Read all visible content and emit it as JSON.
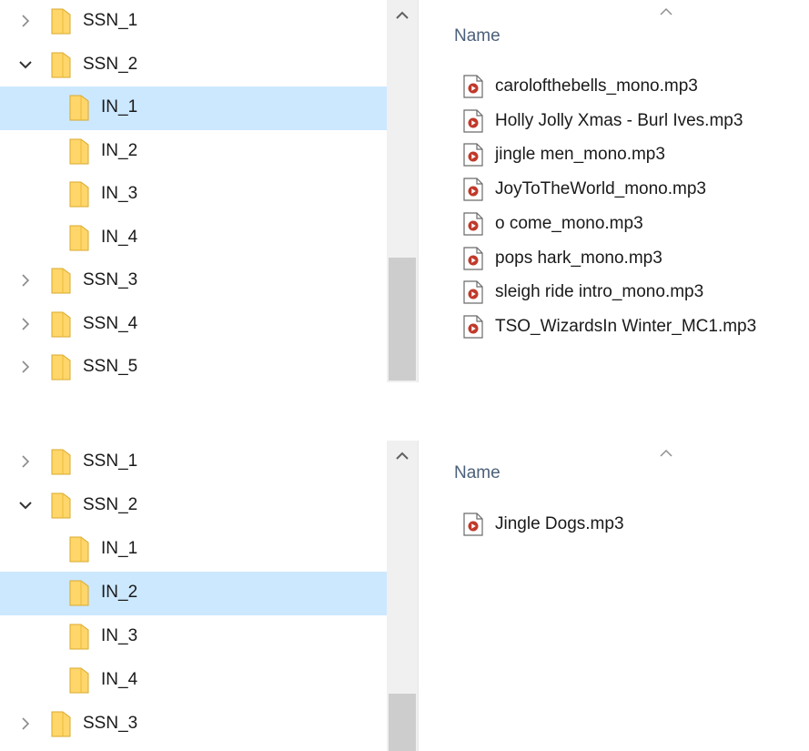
{
  "top": {
    "tree": [
      {
        "label": "SSN_1",
        "expand": "collapsed"
      },
      {
        "label": "SSN_2",
        "expand": "expanded"
      },
      {
        "label": "IN_1",
        "expand": "none",
        "selected": true
      },
      {
        "label": "IN_2",
        "expand": "none"
      },
      {
        "label": "IN_3",
        "expand": "none"
      },
      {
        "label": "IN_4",
        "expand": "none"
      },
      {
        "label": "SSN_3",
        "expand": "collapsed"
      },
      {
        "label": "SSN_4",
        "expand": "collapsed"
      },
      {
        "label": "SSN_5",
        "expand": "collapsed"
      }
    ],
    "column_header": "Name",
    "files": [
      "carolofthebells_mono.mp3",
      "Holly Jolly Xmas - Burl Ives.mp3",
      "jingle men_mono.mp3",
      "JoyToTheWorld_mono.mp3",
      "o come_mono.mp3",
      "pops hark_mono.mp3",
      "sleigh ride intro_mono.mp3",
      "TSO_WizardsIn Winter_MC1.mp3"
    ]
  },
  "bottom": {
    "tree": [
      {
        "label": "SSN_1",
        "expand": "collapsed"
      },
      {
        "label": "SSN_2",
        "expand": "expanded"
      },
      {
        "label": "IN_1",
        "expand": "none"
      },
      {
        "label": "IN_2",
        "expand": "none",
        "selected": true
      },
      {
        "label": "IN_3",
        "expand": "none"
      },
      {
        "label": "IN_4",
        "expand": "none"
      },
      {
        "label": "SSN_3",
        "expand": "collapsed"
      }
    ],
    "column_header": "Name",
    "files": [
      "Jingle Dogs.mp3"
    ]
  },
  "icons": {
    "folder": "folder-icon",
    "audio_file": "audio-file-icon",
    "expand": "chevron-right-icon",
    "collapse": "chevron-down-icon",
    "scroll_up": "scroll-up-arrow-icon",
    "sort": "sort-ascending-icon"
  },
  "colors": {
    "selection": "#cce8ff",
    "folder_fill": "#ffd66a",
    "header_text": "#4c607a",
    "file_icon_accent": "#c0392b"
  }
}
